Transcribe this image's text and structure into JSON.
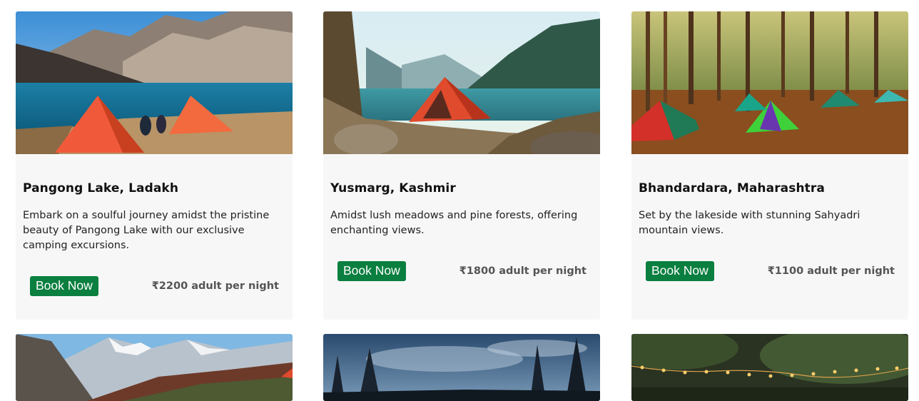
{
  "cards": [
    {
      "title": "Pangong Lake, Ladakh",
      "description": "Embark on a soulful journey amidst the pristine beauty of Pangong Lake with our exclusive camping excursions.",
      "button_label": "Book Now",
      "price": "₹2200 adult per night",
      "image": "pangong-lake-camp-photo"
    },
    {
      "title": "Yusmarg, Kashmir",
      "description": "Amidst lush meadows and pine forests, offering enchanting views.",
      "button_label": "Book Now",
      "price": "₹1800 adult per night",
      "image": "yusmarg-lake-tent-photo"
    },
    {
      "title": "Bhandardara, Maharashtra",
      "description": "Set by the lakeside with stunning Sahyadri mountain views.",
      "button_label": "Book Now",
      "price": "₹1100 adult per night",
      "image": "bhandardara-forest-camp-photo"
    },
    {
      "image": "snowy-mountain-valley-photo"
    },
    {
      "image": "night-sky-pine-forest-photo"
    },
    {
      "image": "palm-trees-string-lights-photo"
    }
  ],
  "colors": {
    "button": "#0a7f3f",
    "card_bg": "#f7f7f7",
    "price": "#555555"
  }
}
